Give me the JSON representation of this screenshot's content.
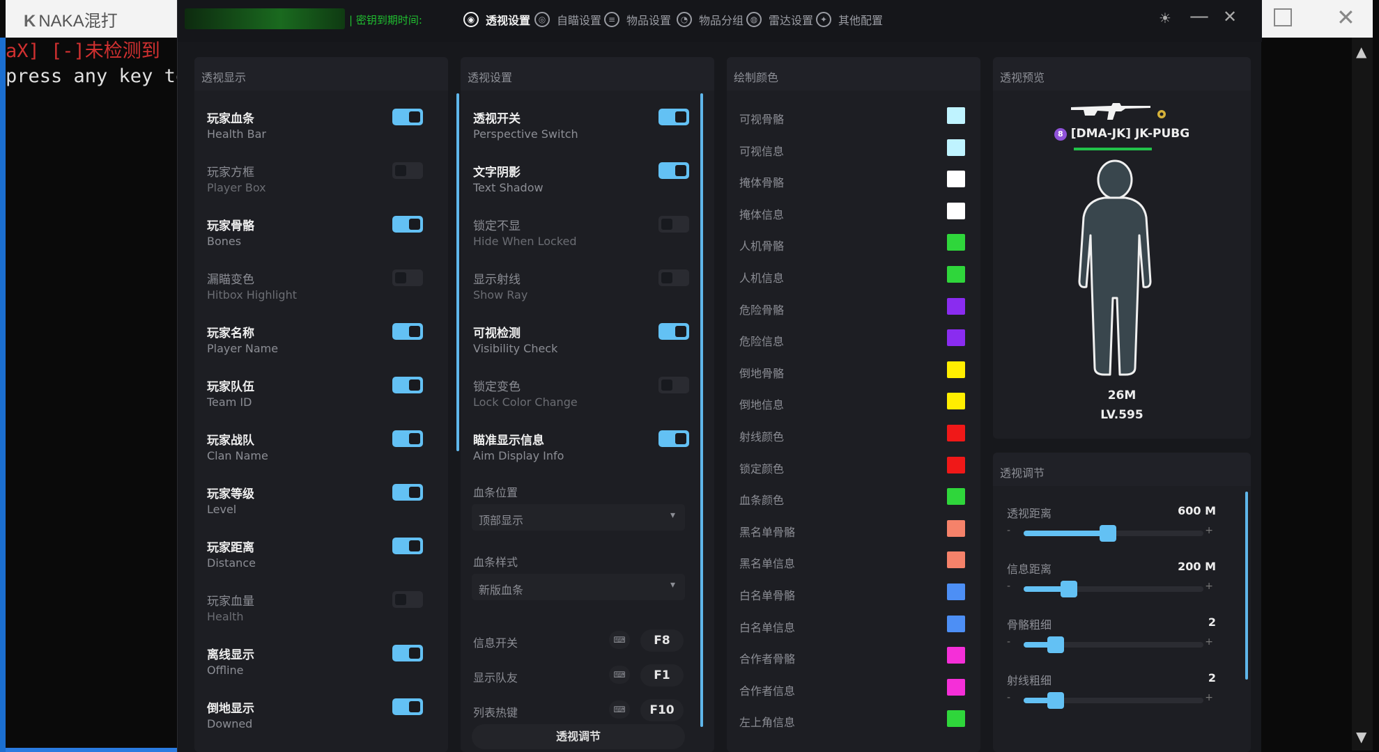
{
  "console": {
    "title_logo": "K",
    "title": "NAKA混打",
    "line1": "aX] [-]未检测到",
    "line2": "press any key to"
  },
  "app": {
    "expire_label": "| 密钥到期时间:",
    "nav": [
      {
        "label": "透视设置",
        "icon": "eye-icon",
        "glyph": "◉",
        "active": true
      },
      {
        "label": "自瞄设置",
        "icon": "target-icon",
        "glyph": "◎",
        "active": false
      },
      {
        "label": "物品设置",
        "icon": "sliders-icon",
        "glyph": "≡",
        "active": false
      },
      {
        "label": "物品分组",
        "icon": "gauge-icon",
        "glyph": "◔",
        "active": false
      },
      {
        "label": "雷达设置",
        "icon": "radar-icon",
        "glyph": "◍",
        "active": false
      },
      {
        "label": "其他配置",
        "icon": "gear-icon",
        "glyph": "✦",
        "active": false
      }
    ],
    "window_controls": {
      "theme": "☀",
      "minimize": "—",
      "close": "✕"
    }
  },
  "display_panel": {
    "title": "透视显示",
    "items": [
      {
        "zh": "玩家血条",
        "en": "Health Bar",
        "on": true
      },
      {
        "zh": "玩家方框",
        "en": "Player Box",
        "on": false
      },
      {
        "zh": "玩家骨骼",
        "en": "Bones",
        "on": true
      },
      {
        "zh": "漏瞄变色",
        "en": "Hitbox Highlight",
        "on": false
      },
      {
        "zh": "玩家名称",
        "en": "Player Name",
        "on": true
      },
      {
        "zh": "玩家队伍",
        "en": "Team ID",
        "on": true
      },
      {
        "zh": "玩家战队",
        "en": "Clan Name",
        "on": true
      },
      {
        "zh": "玩家等级",
        "en": "Level",
        "on": true
      },
      {
        "zh": "玩家距离",
        "en": "Distance",
        "on": true
      },
      {
        "zh": "玩家血量",
        "en": "Health",
        "on": false
      },
      {
        "zh": "离线显示",
        "en": "Offline",
        "on": true
      },
      {
        "zh": "倒地显示",
        "en": "Downed",
        "on": true
      }
    ]
  },
  "settings_panel": {
    "title": "透视设置",
    "items": [
      {
        "zh": "透视开关",
        "en": "Perspective Switch",
        "on": true
      },
      {
        "zh": "文字阴影",
        "en": "Text Shadow",
        "on": true
      },
      {
        "zh": "锁定不显",
        "en": "Hide When Locked",
        "on": false
      },
      {
        "zh": "显示射线",
        "en": "Show Ray",
        "on": false
      },
      {
        "zh": "可视检测",
        "en": "Visibility Check",
        "on": true
      },
      {
        "zh": "锁定变色",
        "en": "Lock Color Change",
        "on": false
      },
      {
        "zh": "瞄准显示信息",
        "en": "Aim Display Info",
        "on": true
      }
    ],
    "dropdowns": [
      {
        "label": "血条位置",
        "value": "顶部显示",
        "arrow": "▾"
      },
      {
        "label": "血条样式",
        "value": "新版血条",
        "arrow": "▾"
      }
    ],
    "keys": [
      {
        "label": "信息开关",
        "kb": "⌨",
        "key": "F8"
      },
      {
        "label": "显示队友",
        "kb": "⌨",
        "key": "F1"
      },
      {
        "label": "列表热键",
        "kb": "⌨",
        "key": "F10"
      }
    ],
    "adjust_button": "透视调节"
  },
  "colors_panel": {
    "title": "绘制颜色",
    "items": [
      {
        "label": "可视骨骼",
        "color": "#bff3ff"
      },
      {
        "label": "可视信息",
        "color": "#bff3ff"
      },
      {
        "label": "掩体骨骼",
        "color": "#ffffff"
      },
      {
        "label": "掩体信息",
        "color": "#ffffff"
      },
      {
        "label": "人机骨骼",
        "color": "#2fd63b"
      },
      {
        "label": "人机信息",
        "color": "#2fd63b"
      },
      {
        "label": "危险骨骼",
        "color": "#8a2cf0"
      },
      {
        "label": "危险信息",
        "color": "#8a2cf0"
      },
      {
        "label": "倒地骨骼",
        "color": "#ffee00"
      },
      {
        "label": "倒地信息",
        "color": "#ffee00"
      },
      {
        "label": "射线颜色",
        "color": "#f01818"
      },
      {
        "label": "锁定颜色",
        "color": "#f01818"
      },
      {
        "label": "血条颜色",
        "color": "#2fd63b"
      },
      {
        "label": "黑名单骨骼",
        "color": "#f5826a"
      },
      {
        "label": "黑名单信息",
        "color": "#f5826a"
      },
      {
        "label": "白名单骨骼",
        "color": "#4d8ff5"
      },
      {
        "label": "白名单信息",
        "color": "#4d8ff5"
      },
      {
        "label": "合作者骨骼",
        "color": "#f52fd8"
      },
      {
        "label": "合作者信息",
        "color": "#f52fd8"
      },
      {
        "label": "左上角信息",
        "color": "#2fd63b"
      }
    ]
  },
  "preview_panel": {
    "title": "透视预览",
    "player_level_badge": "8",
    "player_name": "[DMA-JK] JK-PUBG",
    "health_fraction": 1.0,
    "distance": "26M",
    "level": "LV.595",
    "icons": [
      "rifle-icon",
      "medal-icon",
      "player-silhouette-icon"
    ]
  },
  "adjust_panel": {
    "title": "透视调节",
    "sliders": [
      {
        "label": "透视距离",
        "value_text": "600 M",
        "fraction": 0.47,
        "minus": "-",
        "plus": "+"
      },
      {
        "label": "信息距离",
        "value_text": "200 M",
        "fraction": 0.25,
        "minus": "-",
        "plus": "+"
      },
      {
        "label": "骨骼粗细",
        "value_text": "2",
        "fraction": 0.18,
        "minus": "-",
        "plus": "+"
      },
      {
        "label": "射线粗细",
        "value_text": "2",
        "fraction": 0.18,
        "minus": "-",
        "plus": "+"
      }
    ]
  }
}
